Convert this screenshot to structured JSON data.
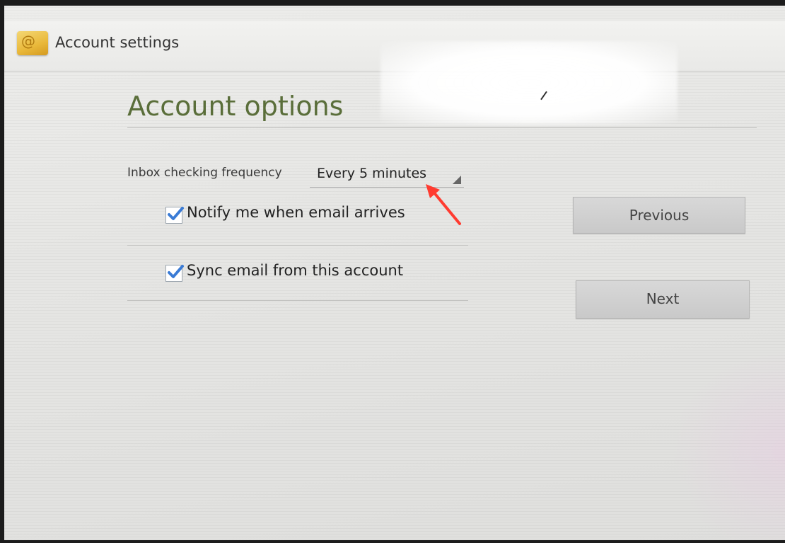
{
  "titlebar": {
    "app_icon": "email-icon",
    "title": "Account settings"
  },
  "main": {
    "heading": "Account options",
    "frequency": {
      "label": "Inbox checking frequency",
      "value": "Every 5 minutes"
    },
    "options": [
      {
        "label": "Notify me when email arrives",
        "checked": true
      },
      {
        "label": "Sync email from this account",
        "checked": true
      }
    ]
  },
  "buttons": {
    "previous": "Previous",
    "next": "Next"
  },
  "colors": {
    "heading": "#5a6e3a",
    "checkbox": "#3a7bd5",
    "callout_arrow": "#ff3b30"
  }
}
